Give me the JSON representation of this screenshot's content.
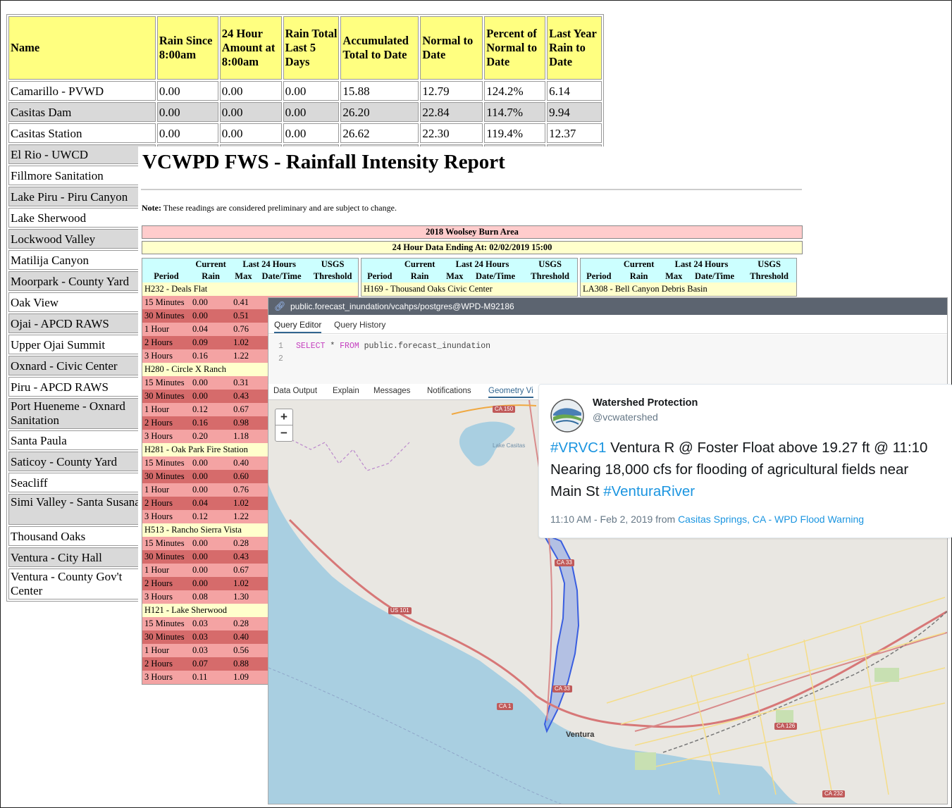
{
  "rainfall": {
    "headers": [
      "Name",
      "Rain Since 8:00am",
      "24 Hour Amount at 8:00am",
      "Rain Total Last 5 Days",
      "Accumulated Total to Date",
      "Normal to Date",
      "Percent of Normal to Date",
      "Last Year Rain to Date"
    ],
    "rows": [
      [
        "Camarillo - PVWD",
        "0.00",
        "0.00",
        "0.00",
        "15.88",
        "12.79",
        "124.2%",
        "6.14"
      ],
      [
        "Casitas Dam",
        "0.00",
        "0.00",
        "0.00",
        "26.20",
        "22.84",
        "114.7%",
        "9.94"
      ],
      [
        "Casitas Station",
        "0.00",
        "0.00",
        "0.00",
        "26.62",
        "22.30",
        "119.4%",
        "12.37"
      ],
      [
        "El Rio - UWCD"
      ],
      [
        "Fillmore Sanitation"
      ],
      [
        "Lake Piru - Piru Canyon"
      ],
      [
        "Lake Sherwood"
      ],
      [
        "Lockwood Valley"
      ],
      [
        "Matilija Canyon"
      ],
      [
        "Moorpark - County Yard"
      ],
      [
        "Oak View"
      ],
      [
        "Ojai - APCD RAWS"
      ],
      [
        "Upper Ojai Summit"
      ],
      [
        "Oxnard - Civic Center"
      ],
      [
        "Piru - APCD RAWS"
      ],
      [
        "Port Hueneme - Oxnard Sanitation"
      ],
      [
        "Santa Paula"
      ],
      [
        "Saticoy - County Yard"
      ],
      [
        "Seacliff"
      ],
      [
        "Simi Valley - Santa Susana"
      ],
      [
        "Thousand Oaks"
      ],
      [
        "Ventura - City Hall"
      ],
      [
        "Ventura - County Gov't Center"
      ]
    ]
  },
  "report": {
    "title": "VCWPD FWS - Rainfall Intensity Report",
    "note_label": "Note:",
    "note_text": " These readings are considered preliminary and are subject to change.",
    "area": "2018 Woolsey Burn Area",
    "data_ending": "24 Hour Data Ending At: 02/02/2019 15:00",
    "col_headers": {
      "current": "Current",
      "last24": "Last 24 Hours",
      "usgs": "USGS",
      "period": "Period",
      "rain": "Rain",
      "max": "Max",
      "datetime": "Date/Time",
      "threshold": "Threshold"
    },
    "columns": [
      {
        "stations": [
          {
            "name": "H232 - Deals Flat",
            "rows": [
              [
                "15 Minutes",
                "0.00",
                "0.41"
              ],
              [
                "30 Minutes",
                "0.00",
                "0.51"
              ],
              [
                "1 Hour",
                "0.04",
                "0.76"
              ],
              [
                "2 Hours",
                "0.09",
                "1.02"
              ],
              [
                "3 Hours",
                "0.16",
                "1.22"
              ]
            ]
          },
          {
            "name": "H280 - Circle X Ranch",
            "rows": [
              [
                "15 Minutes",
                "0.00",
                "0.31"
              ],
              [
                "30 Minutes",
                "0.00",
                "0.43"
              ],
              [
                "1 Hour",
                "0.12",
                "0.67"
              ],
              [
                "2 Hours",
                "0.16",
                "0.98"
              ],
              [
                "3 Hours",
                "0.20",
                "1.18"
              ]
            ]
          },
          {
            "name": "H281 - Oak Park Fire Station",
            "rows": [
              [
                "15 Minutes",
                "0.00",
                "0.40"
              ],
              [
                "30 Minutes",
                "0.00",
                "0.60"
              ],
              [
                "1 Hour",
                "0.00",
                "0.76"
              ],
              [
                "2 Hours",
                "0.04",
                "1.02"
              ],
              [
                "3 Hours",
                "0.12",
                "1.22"
              ]
            ]
          },
          {
            "name": "H513 - Rancho Sierra Vista",
            "rows": [
              [
                "15 Minutes",
                "0.00",
                "0.28"
              ],
              [
                "30 Minutes",
                "0.00",
                "0.43"
              ],
              [
                "1 Hour",
                "0.00",
                "0.67"
              ],
              [
                "2 Hours",
                "0.00",
                "1.02"
              ],
              [
                "3 Hours",
                "0.08",
                "1.30"
              ]
            ]
          },
          {
            "name": "H121 - Lake Sherwood",
            "rows": [
              [
                "15 Minutes",
                "0.03",
                "0.28"
              ],
              [
                "30 Minutes",
                "0.03",
                "0.40"
              ],
              [
                "1 Hour",
                "0.03",
                "0.56"
              ],
              [
                "2 Hours",
                "0.07",
                "0.88"
              ],
              [
                "3 Hours",
                "0.11",
                "1.09"
              ]
            ]
          }
        ]
      },
      {
        "stations": [
          {
            "name": "H169 - Thousand Oaks Civic Center",
            "rows": []
          }
        ]
      },
      {
        "stations": [
          {
            "name": "LA308 - Bell Canyon Debris Basin",
            "rows": []
          }
        ]
      }
    ]
  },
  "pgadmin": {
    "window_title": "public.forecast_inundation/vcahps/postgres@WPD-M92186",
    "tabs": [
      "Query Editor",
      "Query History"
    ],
    "editor_lines": [
      "1",
      "2"
    ],
    "sql_keyword_select": "SELECT",
    "sql_star": " * ",
    "sql_keyword_from": "FROM",
    "sql_table": " public.forecast_inundation",
    "output_tabs": [
      "Data Output",
      "Explain",
      "Messages",
      "Notifications",
      "Geometry Vi"
    ],
    "zoom_in": "+",
    "zoom_out": "−",
    "map_labels": {
      "ventura": "Ventura",
      "us101": "US 101",
      "ca1": "CA 1",
      "ca150": "CA 150",
      "ca33": "CA 33",
      "ca126": "CA 126",
      "ca232": "CA 232",
      "lake": "Lake Casitas"
    }
  },
  "tweet": {
    "name": "Watershed Protection",
    "handle": "@vcwatershed",
    "text_tag1": "#VRVC1",
    "text_body": " Ventura R @ Foster Float above 19.27 ft @ 11:10 Nearing 18,000 cfs for flooding of agricultural fields near Main St ",
    "text_tag2": "#VenturaRiver",
    "meta_time": "11:10 AM - Feb 2, 2019 from ",
    "meta_location": "Casitas Springs, CA - WPD Flood Warning"
  }
}
